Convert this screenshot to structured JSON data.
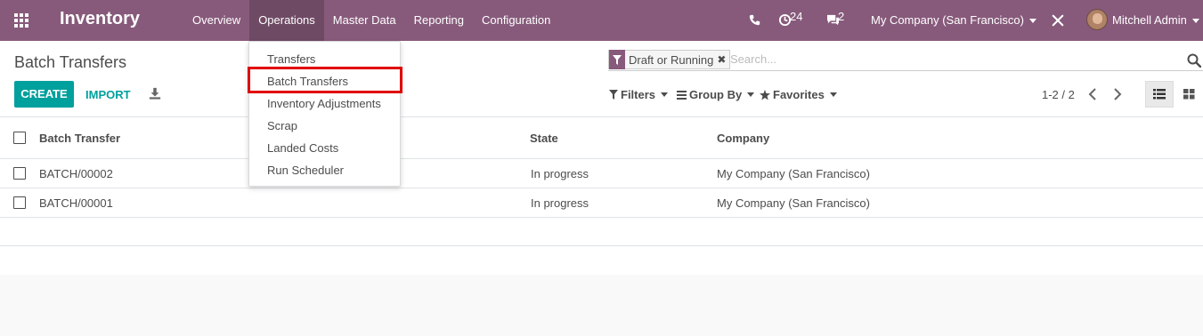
{
  "navbar": {
    "brand": "Inventory",
    "menu": [
      "Overview",
      "Operations",
      "Master Data",
      "Reporting",
      "Configuration"
    ],
    "active_menu": "Operations",
    "activity_count": "24",
    "message_count": "2",
    "company": "My Company (San Francisco)",
    "user": "Mitchell Admin"
  },
  "dropdown": {
    "items": [
      "Transfers",
      "Batch Transfers",
      "Inventory Adjustments",
      "Scrap",
      "Landed Costs",
      "Run Scheduler"
    ],
    "highlighted": "Batch Transfers"
  },
  "control": {
    "breadcrumb": "Batch Transfers",
    "create_label": "CREATE",
    "import_label": "IMPORT",
    "facet_label": "Draft or Running",
    "search_placeholder": "Search...",
    "filters_label": "Filters",
    "groupby_label": "Group By",
    "favorites_label": "Favorites",
    "pager": "1-2 / 2"
  },
  "table": {
    "columns": [
      "Batch Transfer",
      "State",
      "Company"
    ],
    "rows": [
      [
        "BATCH/00002",
        "In progress",
        "My Company (San Francisco)"
      ],
      [
        "BATCH/00001",
        "In progress",
        "My Company (San Francisco)"
      ]
    ]
  },
  "colors": {
    "navbar": "#875a7b",
    "primary": "#00a09d",
    "highlight": "#e00000"
  }
}
